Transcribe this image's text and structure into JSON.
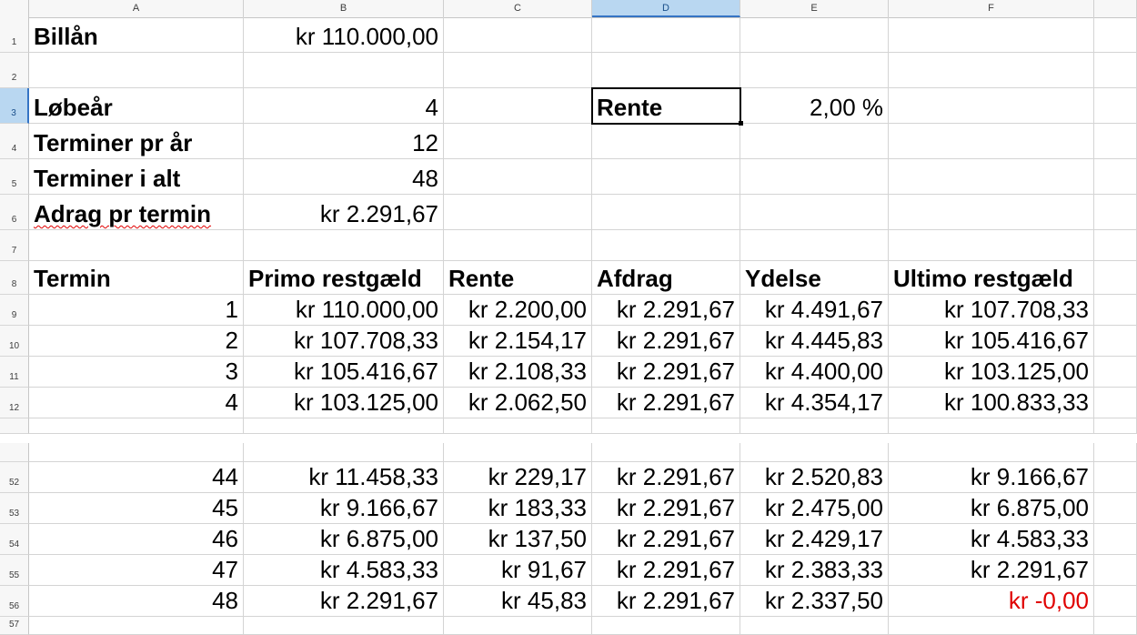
{
  "columns": [
    "A",
    "B",
    "C",
    "D",
    "E",
    "F"
  ],
  "active_column": "D",
  "active_row": "3",
  "rows": [
    {
      "num": "1",
      "cells": {
        "A": "Billån",
        "B": "kr 110.000,00"
      }
    },
    {
      "num": "2",
      "cells": {}
    },
    {
      "num": "3",
      "cells": {
        "A": "Løbeår",
        "B": "4",
        "D": "Rente",
        "E": "2,00 %"
      }
    },
    {
      "num": "4",
      "cells": {
        "A": "Terminer pr år",
        "B": "12"
      }
    },
    {
      "num": "5",
      "cells": {
        "A": "Terminer i alt",
        "B": "48"
      }
    },
    {
      "num": "6",
      "cells": {
        "A": "Adrag pr termin",
        "B": "kr 2.291,67"
      }
    },
    {
      "num": "7",
      "cells": {}
    },
    {
      "num": "8",
      "cells": {
        "A": "Termin",
        "B": "Primo restgæld",
        "C": "Rente",
        "D": "Afdrag",
        "E": "Ydelse",
        "F": "Ultimo restgæld"
      }
    },
    {
      "num": "9",
      "cells": {
        "A": "1",
        "B": "kr 110.000,00",
        "C": "kr 2.200,00",
        "D": "kr 2.291,67",
        "E": "kr 4.491,67",
        "F": "kr 107.708,33"
      }
    },
    {
      "num": "10",
      "cells": {
        "A": "2",
        "B": "kr 107.708,33",
        "C": "kr 2.154,17",
        "D": "kr 2.291,67",
        "E": "kr 4.445,83",
        "F": "kr 105.416,67"
      }
    },
    {
      "num": "11",
      "cells": {
        "A": "3",
        "B": "kr 105.416,67",
        "C": "kr 2.108,33",
        "D": "kr 2.291,67",
        "E": "kr 4.400,00",
        "F": "kr 103.125,00"
      }
    },
    {
      "num": "12",
      "cells": {
        "A": "4",
        "B": "kr 103.125,00",
        "C": "kr 2.062,50",
        "D": "kr 2.291,67",
        "E": "kr 4.354,17",
        "F": "kr 100.833,33"
      }
    },
    {
      "num": "",
      "cells": {}
    },
    {
      "num": "",
      "cells": {}
    },
    {
      "num": "52",
      "cells": {
        "A": "44",
        "B": "kr 11.458,33",
        "C": "kr 229,17",
        "D": "kr 2.291,67",
        "E": "kr 2.520,83",
        "F": "kr 9.166,67"
      }
    },
    {
      "num": "53",
      "cells": {
        "A": "45",
        "B": "kr 9.166,67",
        "C": "kr 183,33",
        "D": "kr 2.291,67",
        "E": "kr 2.475,00",
        "F": "kr 6.875,00"
      }
    },
    {
      "num": "54",
      "cells": {
        "A": "46",
        "B": "kr 6.875,00",
        "C": "kr 137,50",
        "D": "kr 2.291,67",
        "E": "kr 2.429,17",
        "F": "kr 4.583,33"
      }
    },
    {
      "num": "55",
      "cells": {
        "A": "47",
        "B": "kr 4.583,33",
        "C": "kr 91,67",
        "D": "kr 2.291,67",
        "E": "kr 2.383,33",
        "F": "kr 2.291,67"
      }
    },
    {
      "num": "56",
      "cells": {
        "A": "48",
        "B": "kr 2.291,67",
        "C": "kr 45,83",
        "D": "kr 2.291,67",
        "E": "kr 2.337,50",
        "F": "kr -0,00"
      }
    },
    {
      "num": "57",
      "cells": {}
    }
  ],
  "colors": {
    "negative": "#e00000",
    "selection": "#000000",
    "active_header": "#b9d7f1"
  }
}
